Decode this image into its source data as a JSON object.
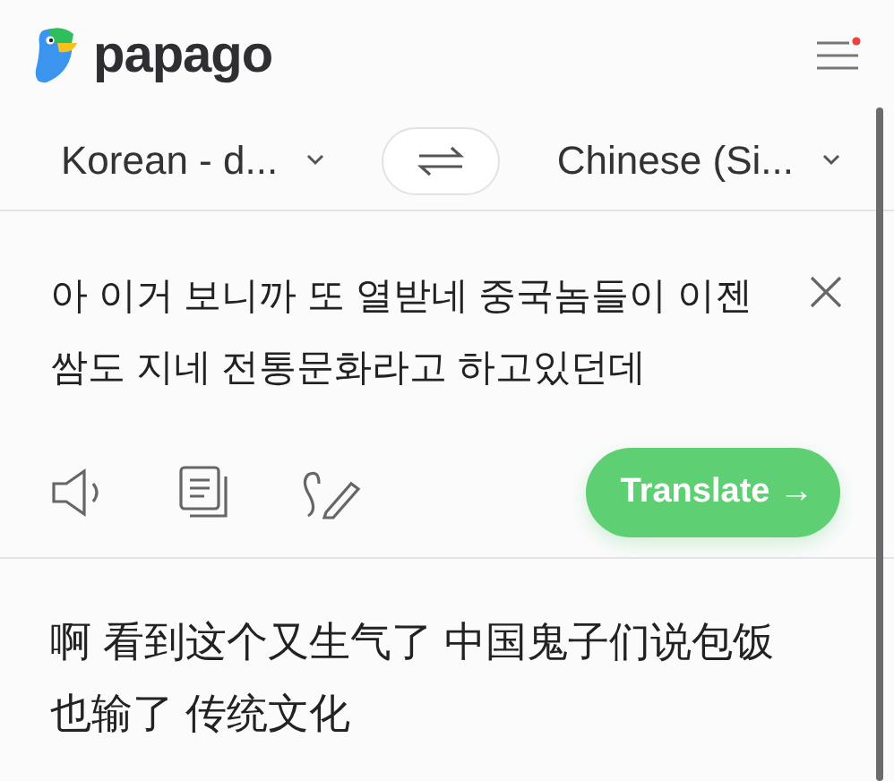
{
  "app": {
    "name": "papago"
  },
  "languages": {
    "source": "Korean - d...",
    "target": "Chinese (Si..."
  },
  "source": {
    "text": "아 이거 보니까 또 열받네 중국놈들이 이젠 쌈도 지네 전통문화라고 하고있던데",
    "translate_label": "Translate →"
  },
  "result": {
    "text": "啊 看到这个又生气了 中国鬼子们说包饭也输了 传统文化"
  }
}
